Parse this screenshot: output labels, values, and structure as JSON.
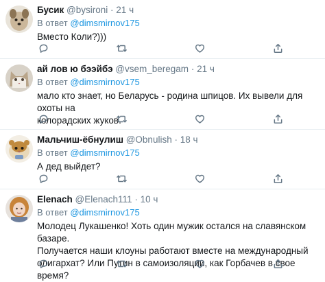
{
  "tweets": [
    {
      "name": "Бусик",
      "handle": "@bysironi",
      "dot": "·",
      "time": "21 ч",
      "reply_prefix": "В ответ",
      "reply_to": "@dimsmirnov175",
      "lines": [
        "Вместо Коли?)))"
      ],
      "avatar": "dog-avatar",
      "avatar_colors": [
        "#cbb79a",
        "#6d5b45"
      ]
    },
    {
      "name": "ай лов ю бээйбэ",
      "handle": "@vsem_beregam",
      "dot": "·",
      "time": "21 ч",
      "reply_prefix": "В ответ",
      "reply_to": "@dimsmirnov175",
      "lines": [
        "мало кто знает, но Беларусь - родина шпицов. Их вывели для охоты на",
        "колорадских жуков."
      ],
      "avatar": "cat-avatar",
      "avatar_colors": [
        "#b9a58a",
        "#4e4236"
      ]
    },
    {
      "name": "Мальчиш-ёбнулиш",
      "handle": "@Obnulish",
      "dot": "·",
      "time": "18 ч",
      "reply_prefix": "В ответ",
      "reply_to": "@dimsmirnov175",
      "lines": [
        "А дед выйдет?"
      ],
      "avatar": "hamster-avatar",
      "avatar_colors": [
        "#e8d8b8",
        "#c08a3e"
      ]
    },
    {
      "name": "Elenach",
      "handle": "@Elenach111",
      "dot": "·",
      "time": "10 ч",
      "reply_prefix": "В ответ",
      "reply_to": "@dimsmirnov175",
      "lines": [
        "Молодец Лукашенко! Хоть один мужик остался на славянском базаре.",
        "Получается наши клоуны работают вместе на международный",
        "олигархат? Или Путин в самоизоляции, как Горбачев в свое время?"
      ],
      "avatar": "woman-avatar",
      "avatar_colors": [
        "#f1d6c6",
        "#c8843a"
      ]
    }
  ],
  "icons": [
    "reply-icon",
    "retweet-icon",
    "like-icon",
    "share-icon"
  ],
  "colors": {
    "link": "#1b95e0",
    "muted": "#657786",
    "text": "#14171a",
    "divider": "#e6ecf0"
  }
}
